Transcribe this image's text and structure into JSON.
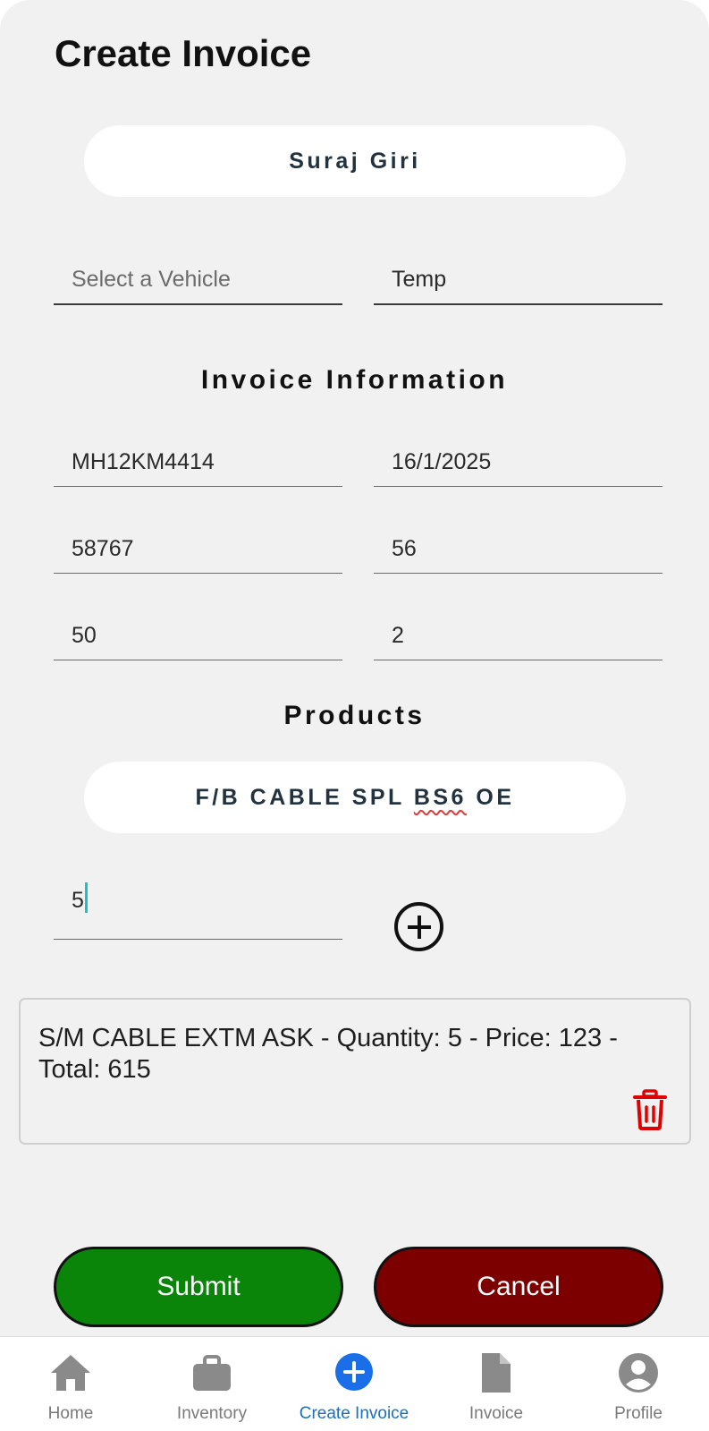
{
  "header": {
    "title": "Create Invoice"
  },
  "customer": {
    "name": "Suraj Giri"
  },
  "vehicle": {
    "select_placeholder": "Select a Vehicle",
    "type_value": "Temp"
  },
  "invoice_info": {
    "title": "Invoice Information",
    "fields": [
      "MH12KM4414",
      "16/1/2025",
      "58767",
      "56",
      "50",
      "2"
    ]
  },
  "products": {
    "title": "Products",
    "selected_product_prefix": "F/B CABLE SPL ",
    "selected_product_flagged": "BS6",
    "selected_product_suffix": " OE",
    "quantity_value": "5",
    "items": [
      {
        "text": "S/M CABLE EXTM ASK - Quantity: 5 - Price: 123 - Total: 615"
      }
    ]
  },
  "actions": {
    "submit_label": "Submit",
    "cancel_label": "Cancel"
  },
  "colors": {
    "submit": "#0a850a",
    "cancel": "#7c0000",
    "active_tab": "#1a6fbf",
    "delete": "#e10000"
  },
  "nav": {
    "items": [
      {
        "label": "Home",
        "icon": "home-icon"
      },
      {
        "label": "Inventory",
        "icon": "briefcase-icon"
      },
      {
        "label": "Create Invoice",
        "icon": "plus-circle-icon",
        "active": true
      },
      {
        "label": "Invoice",
        "icon": "document-icon"
      },
      {
        "label": "Profile",
        "icon": "account-circle-icon"
      }
    ]
  }
}
